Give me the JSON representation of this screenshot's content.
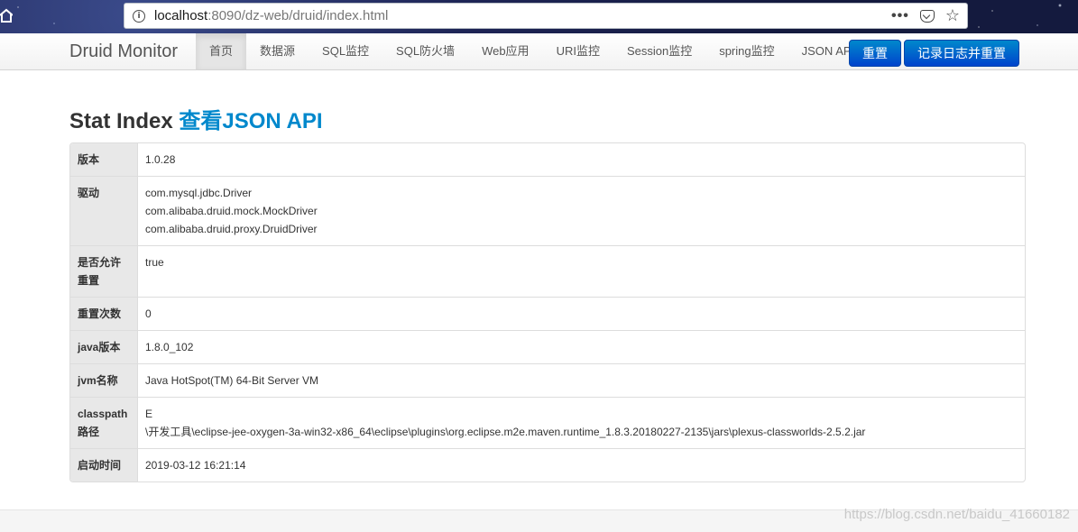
{
  "browser": {
    "url_host": "localhost",
    "url_rest": ":8090/dz-web/druid/index.html"
  },
  "navbar": {
    "brand": "Druid Monitor",
    "items": [
      {
        "label": "首页",
        "active": true
      },
      {
        "label": "数据源"
      },
      {
        "label": "SQL监控"
      },
      {
        "label": "SQL防火墙"
      },
      {
        "label": "Web应用"
      },
      {
        "label": "URI监控"
      },
      {
        "label": "Session监控"
      },
      {
        "label": "spring监控"
      },
      {
        "label": "JSON API"
      }
    ],
    "reset_button": "重置",
    "log_reset_button": "记录日志并重置",
    "button_color": "#0055cc"
  },
  "main": {
    "title": "Stat Index",
    "title_link": "查看JSON API",
    "rows": [
      {
        "key": "版本",
        "value": [
          "1.0.28"
        ]
      },
      {
        "key": "驱动",
        "value": [
          "com.mysql.jdbc.Driver",
          "com.alibaba.druid.mock.MockDriver",
          "com.alibaba.druid.proxy.DruidDriver"
        ]
      },
      {
        "key": "是否允许重置",
        "value": [
          "true"
        ]
      },
      {
        "key": "重置次数",
        "value": [
          "0"
        ]
      },
      {
        "key": "java版本",
        "value": [
          "1.8.0_102"
        ]
      },
      {
        "key": "jvm名称",
        "value": [
          "Java HotSpot(TM) 64-Bit Server VM"
        ]
      },
      {
        "key": "classpath路径",
        "value": [
          "E",
          "\\开发工具\\eclipse-jee-oxygen-3a-win32-x86_64\\eclipse\\plugins\\org.eclipse.m2e.maven.runtime_1.8.3.20180227-2135\\jars\\plexus-classworlds-2.5.2.jar"
        ]
      },
      {
        "key": "启动时间",
        "value": [
          "2019-03-12 16:21:14"
        ]
      }
    ]
  },
  "watermark": "https://blog.csdn.net/baidu_41660182"
}
